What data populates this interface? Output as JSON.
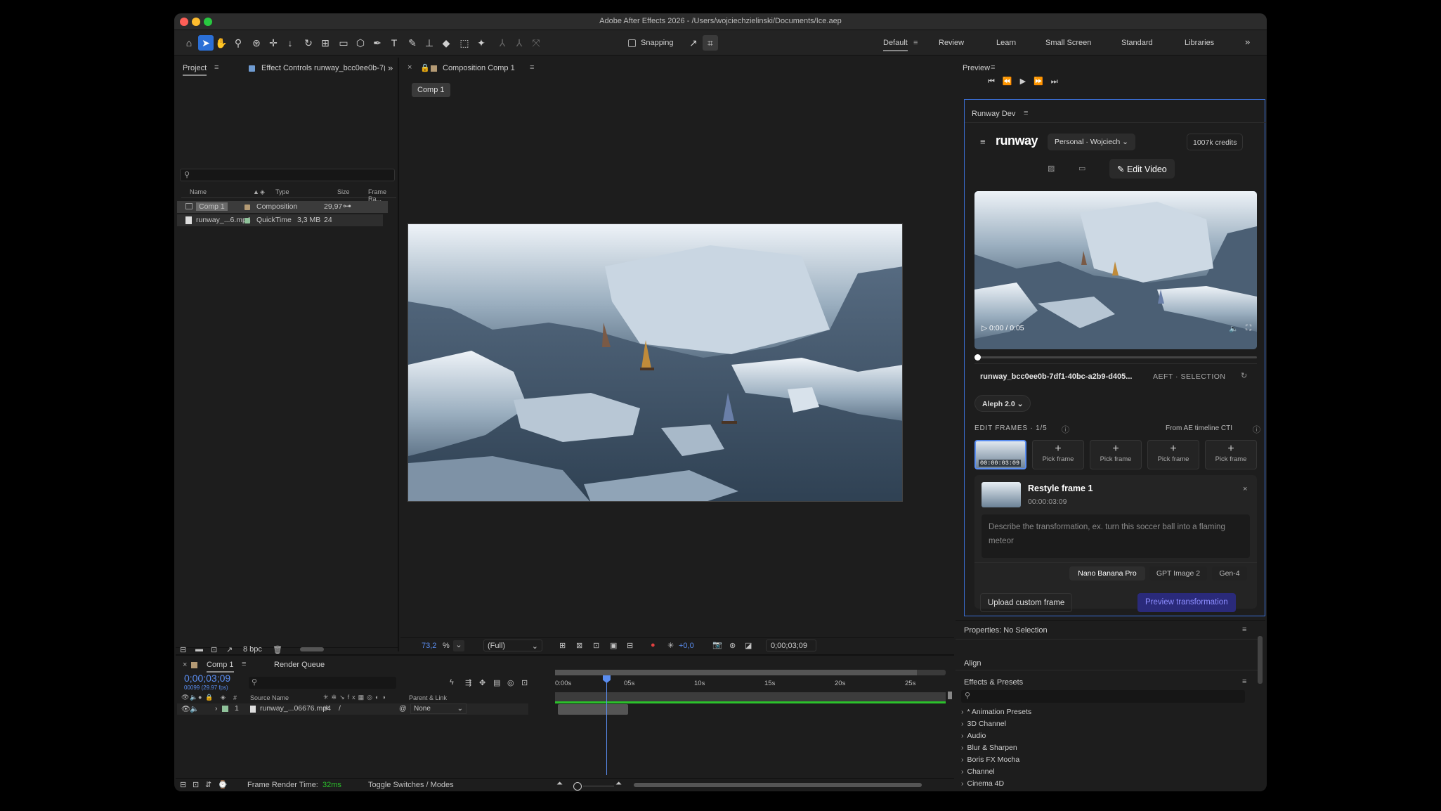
{
  "window": {
    "title": "Adobe After Effects 2026 - /Users/wojciechzielinski/Documents/Ice.aep"
  },
  "toolbar": {
    "snapping_label": "Snapping",
    "workspaces": [
      "Default",
      "Review",
      "Learn",
      "Small Screen",
      "Standard",
      "Libraries"
    ],
    "more": "»"
  },
  "project": {
    "tab_label": "Project",
    "effect_controls_label": "Effect Controls runway_bcc0ee0b-7(",
    "more": "»",
    "columns": [
      "Name",
      "Type",
      "Size",
      "Frame Ra..."
    ],
    "items": [
      {
        "name": "Comp 1",
        "type": "Composition",
        "size": "",
        "fps": "29,97"
      },
      {
        "name": "runway_...6.mp4",
        "type": "QuickTime",
        "size": "3,3 MB",
        "fps": "24"
      }
    ],
    "bpc": "8 bpc"
  },
  "composition": {
    "tab_label": "Composition Comp 1",
    "breadcrumb": "Comp 1",
    "zoom": "73,2",
    "zoom_unit": "%",
    "resolution": "(Full)",
    "exposure": "+0,0",
    "timecode": "0;00;03;09"
  },
  "preview": {
    "title": "Preview"
  },
  "runway": {
    "panel_title": "Runway Dev",
    "logo": "runway",
    "workspace": "Personal · Wojciech",
    "credits": "1007k credits",
    "edit_video": "Edit Video",
    "video_time": "0:00 / 0:05",
    "file_name": "runway_bcc0ee0b-7df1-40bc-a2b9-d405...",
    "source": "AEFT · SELECTION",
    "model": "Aleph 2.0",
    "edit_frames_label": "EDIT FRAMES · 1/5",
    "from_cti": "From AE timeline CTI",
    "frame1_time": "00:00:03:09",
    "pick_frame": "Pick frame",
    "restyle_title": "Restyle frame 1",
    "restyle_time": "00:00:03:09",
    "prompt_placeholder": "Describe the transformation, ex. turn this soccer ball into a flaming meteor",
    "models": [
      "Nano Banana Pro",
      "GPT Image 2",
      "Gen-4"
    ],
    "upload_label": "Upload custom frame",
    "preview_label": "Preview transformation"
  },
  "properties": {
    "title": "Properties: No Selection",
    "align": "Align",
    "effects_title": "Effects & Presets",
    "tree": [
      "* Animation Presets",
      "3D Channel",
      "Audio",
      "Blur & Sharpen",
      "Boris FX Mocha",
      "Channel",
      "Cinema 4D"
    ]
  },
  "timeline": {
    "tab_label": "Comp 1",
    "render_queue": "Render Queue",
    "timecode": "0;00;03;09",
    "timecode_sub": "00099 (29.97 fps)",
    "col_num": "#",
    "col_source": "Source Name",
    "col_parent": "Parent & Link",
    "layer": {
      "index": "1",
      "name": "runway_...06676.mp4",
      "parent": "None"
    },
    "ticks": [
      "0:00s",
      "05s",
      "10s",
      "15s",
      "20s",
      "25s"
    ],
    "frame_render_label": "Frame Render Time:",
    "frame_render_value": "32ms",
    "toggle_label": "Toggle Switches / Modes"
  },
  "colors": {
    "accent": "#2b6fd6",
    "highlight_blue": "#5a8df0",
    "green": "#2bc12b",
    "runway_button": "#2a2a7a"
  }
}
